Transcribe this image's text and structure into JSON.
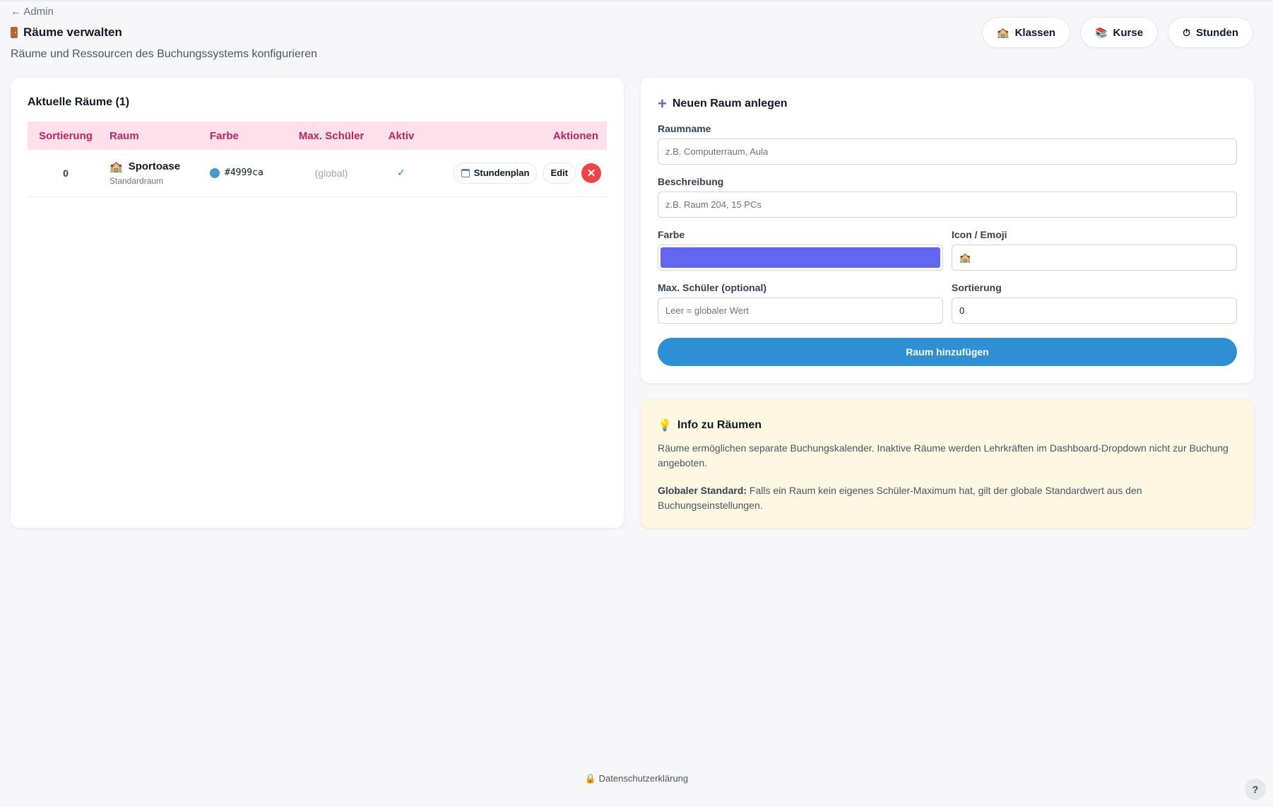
{
  "header": {
    "back_label": "← Admin",
    "title": "Räume verwalten",
    "subtitle": "Räume und Ressourcen des Buchungssystems konfigurieren"
  },
  "nav": [
    {
      "label": "Klassen",
      "icon": "🏫"
    },
    {
      "label": "Kurse",
      "icon": "📚"
    },
    {
      "label": "Stunden",
      "icon": "⏱"
    }
  ],
  "rooms_card": {
    "title": "Aktuelle Räume (1)",
    "columns": [
      "Sortierung",
      "Raum",
      "Farbe",
      "Max. Schüler",
      "Aktiv",
      "Aktionen"
    ],
    "rows": [
      {
        "sort": "0",
        "icon": "🏫",
        "name": "Sportoase",
        "desc": "Standardraum",
        "color": "#4999ca",
        "max": "(global)",
        "active": "✓",
        "schedule_label": "Stundenplan",
        "edit_label": "Edit",
        "delete_symbol": "✕"
      }
    ]
  },
  "form": {
    "title": "Neuen Raum anlegen",
    "name_label": "Raumname",
    "name_placeholder": "z.B. Computerraum, Aula",
    "desc_label": "Beschreibung",
    "desc_placeholder": "z.B. Raum 204, 15 PCs",
    "color_label": "Farbe",
    "color_value": "#6366f1",
    "icon_label": "Icon / Emoji",
    "icon_value": "🏫",
    "max_label": "Max. Schüler (optional)",
    "max_placeholder": "Leer = globaler Wert",
    "sort_label": "Sortierung",
    "sort_value": "0",
    "submit_label": "Raum hinzufügen"
  },
  "info": {
    "title": "Info zu Räumen",
    "p1": "Räume ermöglichen separate Buchungskalender. Inaktive Räume werden Lehrkräften im Dashboard-Dropdown nicht zur Buchung angeboten.",
    "p2_bold": "Globaler Standard:",
    "p2_text": " Falls ein Raum kein eigenes Schüler-Maximum hat, gilt der globale Standardwert aus den Buchungseinstellungen."
  },
  "footer": {
    "icon": "🔒",
    "label": "Datenschutzerklärung"
  },
  "help_label": "?"
}
